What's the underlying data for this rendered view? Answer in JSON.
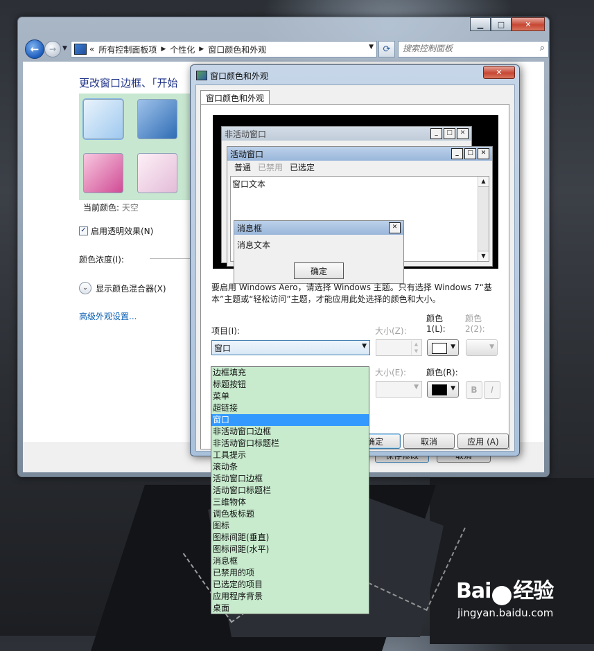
{
  "control_panel": {
    "breadcrumbs": [
      "所有控制面板项",
      "个性化",
      "窗口颜色和外观"
    ],
    "crumb_prefix": "«",
    "search_placeholder": "搜索控制面板",
    "title": "更改窗口边框、「开始",
    "current_color_label": "当前颜色:",
    "current_color_value": "天空",
    "transparency_label": "启用透明效果(N)",
    "intensity_label": "颜色浓度(I):",
    "mixer_label": "显示颜色混合器(X)",
    "advanced_link": "高级外观设置...",
    "save_button": "保存修改",
    "cancel_button": "取消"
  },
  "dialog": {
    "title": "窗口颜色和外观",
    "tab_label": "窗口颜色和外观",
    "preview": {
      "inactive_window": "非活动窗口",
      "active_window": "活动窗口",
      "menu_normal": "普通",
      "menu_disabled": "已禁用",
      "menu_selected": "已选定",
      "window_text": "窗口文本",
      "message_box": "消息框",
      "message_text": "消息文本",
      "ok": "确定"
    },
    "note": "要启用 Windows Aero，请选择 Windows 主题。只有选择 Windows 7“基本”主题或“轻松访问”主题，才能应用此处选择的颜色和大小。",
    "item_label": "项目(I):",
    "item_value": "窗口",
    "size_label": "大小(Z):",
    "color1_label_a": "颜色",
    "color1_label_b": "1(L):",
    "color2_label_a": "颜色",
    "color2_label_b": "2(2):",
    "font_size_label": "大小(E):",
    "font_color_label": "颜色(R):",
    "bold": "B",
    "italic": "I",
    "ok_button": "确定",
    "cancel_button": "取消",
    "apply_button": "应用 (A)",
    "color1_swatch": "#ffffff",
    "font_color_swatch": "#000000",
    "dropdown_items": [
      "边框填充",
      "标题按钮",
      "菜单",
      "超链接",
      "窗口",
      "非活动窗口边框",
      "非活动窗口标题栏",
      "工具提示",
      "滚动条",
      "活动窗口边框",
      "活动窗口标题栏",
      "三维物体",
      "调色板标题",
      "图标",
      "图标间距(垂直)",
      "图标间距(水平)",
      "消息框",
      "已禁用的项",
      "已选定的项目",
      "应用程序背景",
      "桌面"
    ],
    "selected_index": 4
  },
  "watermark": {
    "brand_a": "Bai",
    "brand_b": "经验",
    "url": "jingyan.baidu.com"
  }
}
